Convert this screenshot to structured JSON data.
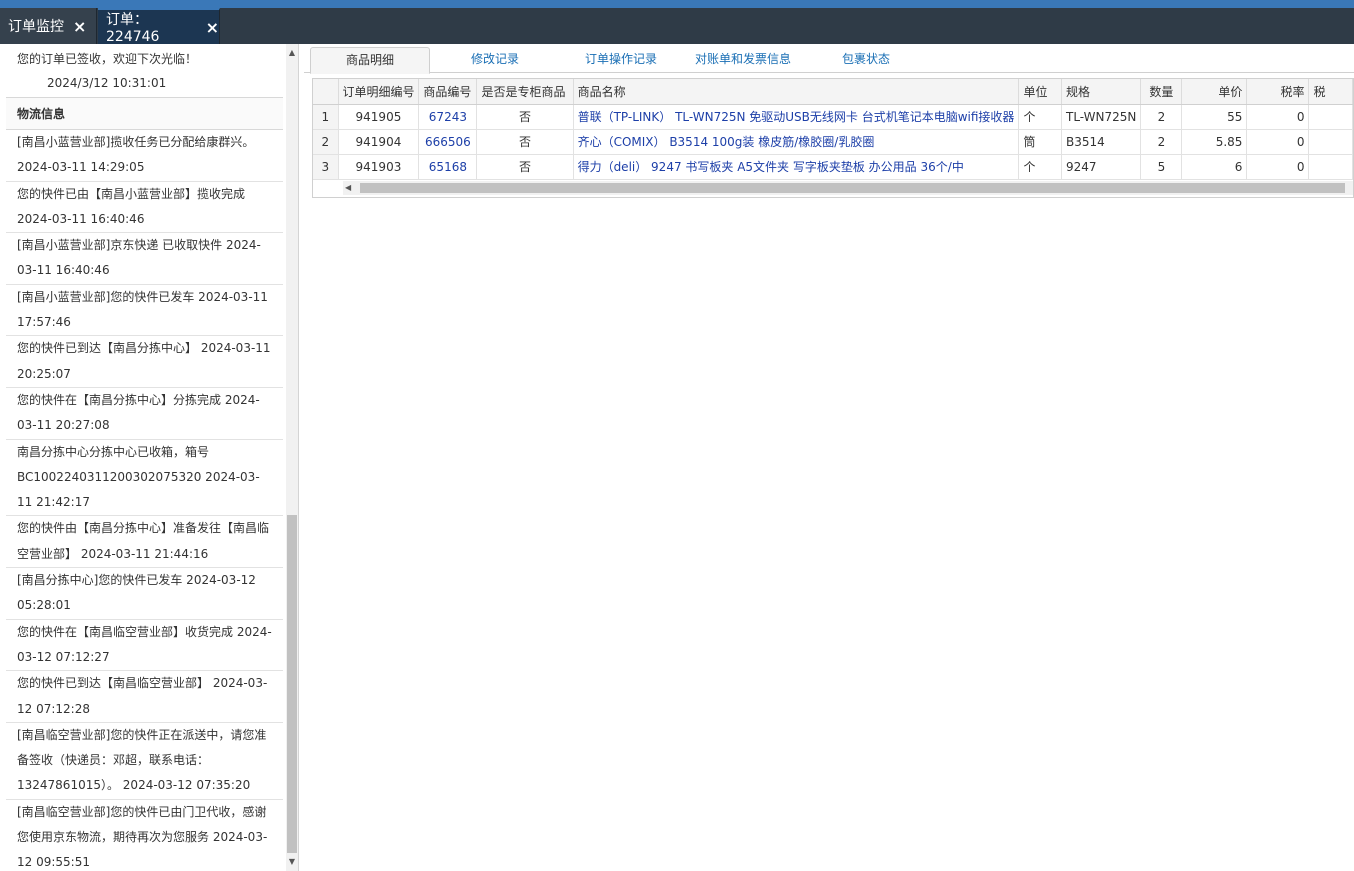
{
  "tabs": [
    {
      "label": "订单监控",
      "close": "×"
    },
    {
      "label": "订单：224746",
      "close": "×"
    }
  ],
  "left": {
    "signed_text": "您的订单已签收，欢迎下次光临！",
    "signed_time": "2024/3/12 10:31:01",
    "logistics_title": "物流信息",
    "logs": [
      "[南昌小蓝营业部]揽收任务已分配给康群兴。 2024-03-11 14:29:05",
      "您的快件已由【南昌小蓝营业部】揽收完成 2024-03-11 16:40:46",
      "[南昌小蓝营业部]京东快递 已收取快件 2024-03-11 16:40:46",
      "[南昌小蓝营业部]您的快件已发车 2024-03-11 17:57:46",
      "您的快件已到达【南昌分拣中心】 2024-03-11 20:25:07",
      "您的快件在【南昌分拣中心】分拣完成 2024-03-11 20:27:08",
      "南昌分拣中心分拣中心已收箱，箱号BC1002240311200302075320 2024-03-11 21:42:17",
      "您的快件由【南昌分拣中心】准备发往【南昌临空营业部】 2024-03-11 21:44:16",
      "[南昌分拣中心]您的快件已发车 2024-03-12 05:28:01",
      "您的快件在【南昌临空营业部】收货完成 2024-03-12 07:12:27",
      "您的快件已到达【南昌临空营业部】 2024-03-12 07:12:28",
      "[南昌临空营业部]您的快件正在派送中，请您准备签收（快递员：邓超，联系电话：13247861015）。 2024-03-12 07:35:20",
      "[南昌临空营业部]您的快件已由门卫代收，感谢您使用京东物流，期待再次为您服务 2024-03-12 09:55:51"
    ]
  },
  "subtabs": [
    "商品明细",
    "修改记录",
    "订单操作记录",
    "对账单和发票信息",
    "包裹状态"
  ],
  "table": {
    "headers": [
      "",
      "订单明细编号",
      "商品编号",
      "是否是专柜商品",
      "商品名称",
      "单位",
      "规格",
      "数量",
      "单价",
      "税率",
      "税"
    ],
    "rows": [
      [
        "1",
        "941905",
        "67243",
        "否",
        "普联（TP-LINK） TL-WN725N 免驱动USB无线网卡 台式机笔记本电脑wifi接收器",
        "个",
        "TL-WN725N",
        "2",
        "55",
        "0"
      ],
      [
        "2",
        "941904",
        "666506",
        "否",
        "齐心（COMIX） B3514 100g装 橡皮筋/橡胶圈/乳胶圈",
        "筒",
        "B3514",
        "2",
        "5.85",
        "0"
      ],
      [
        "3",
        "941903",
        "65168",
        "否",
        "得力（deli） 9247 书写板夹 A5文件夹 写字板夹垫板 办公用品 36个/中",
        "个",
        "9247",
        "5",
        "6",
        "0"
      ]
    ]
  },
  "scroll_icons": {
    "up": "▲",
    "down": "▼",
    "left": "◀"
  }
}
